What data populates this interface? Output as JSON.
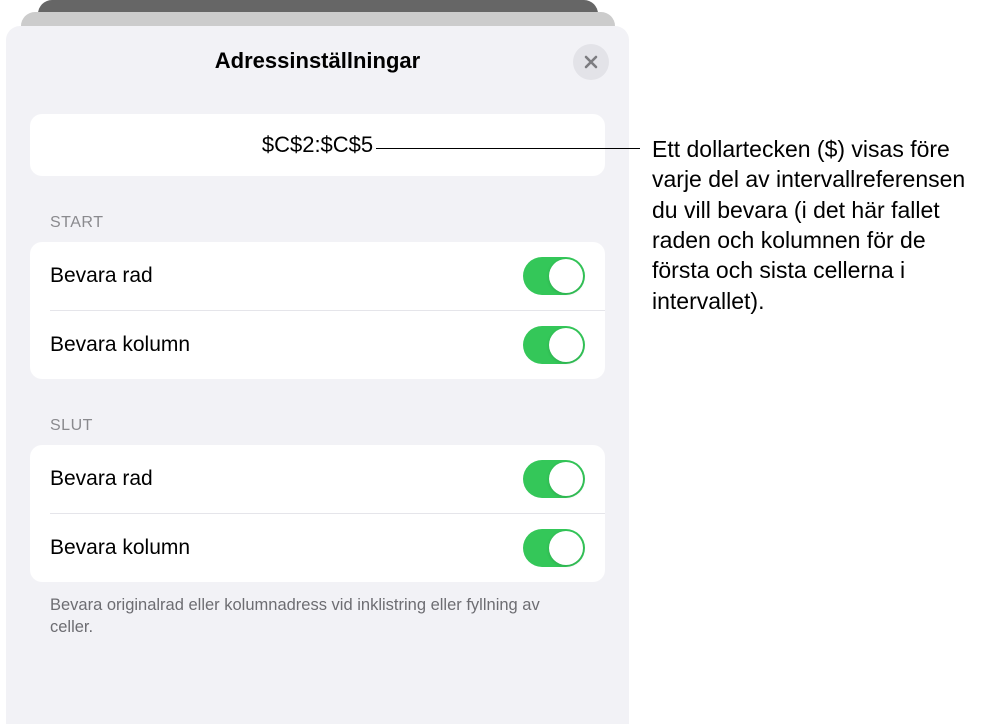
{
  "header": {
    "title": "Adressinställningar"
  },
  "address": "$C$2:$C$5",
  "sections": {
    "start": {
      "label": "Start",
      "preserve_row": "Bevara rad",
      "preserve_column": "Bevara kolumn"
    },
    "end": {
      "label": "Slut",
      "preserve_row": "Bevara rad",
      "preserve_column": "Bevara kolumn"
    }
  },
  "footer": "Bevara originalrad eller kolumnadress vid inklistring eller fyllning av celler.",
  "callout": "Ett dollartecken ($) visas före varje del av intervallreferensen du vill bevara (i det här fallet raden och kolumnen för de första och sista cellerna i intervallet)."
}
